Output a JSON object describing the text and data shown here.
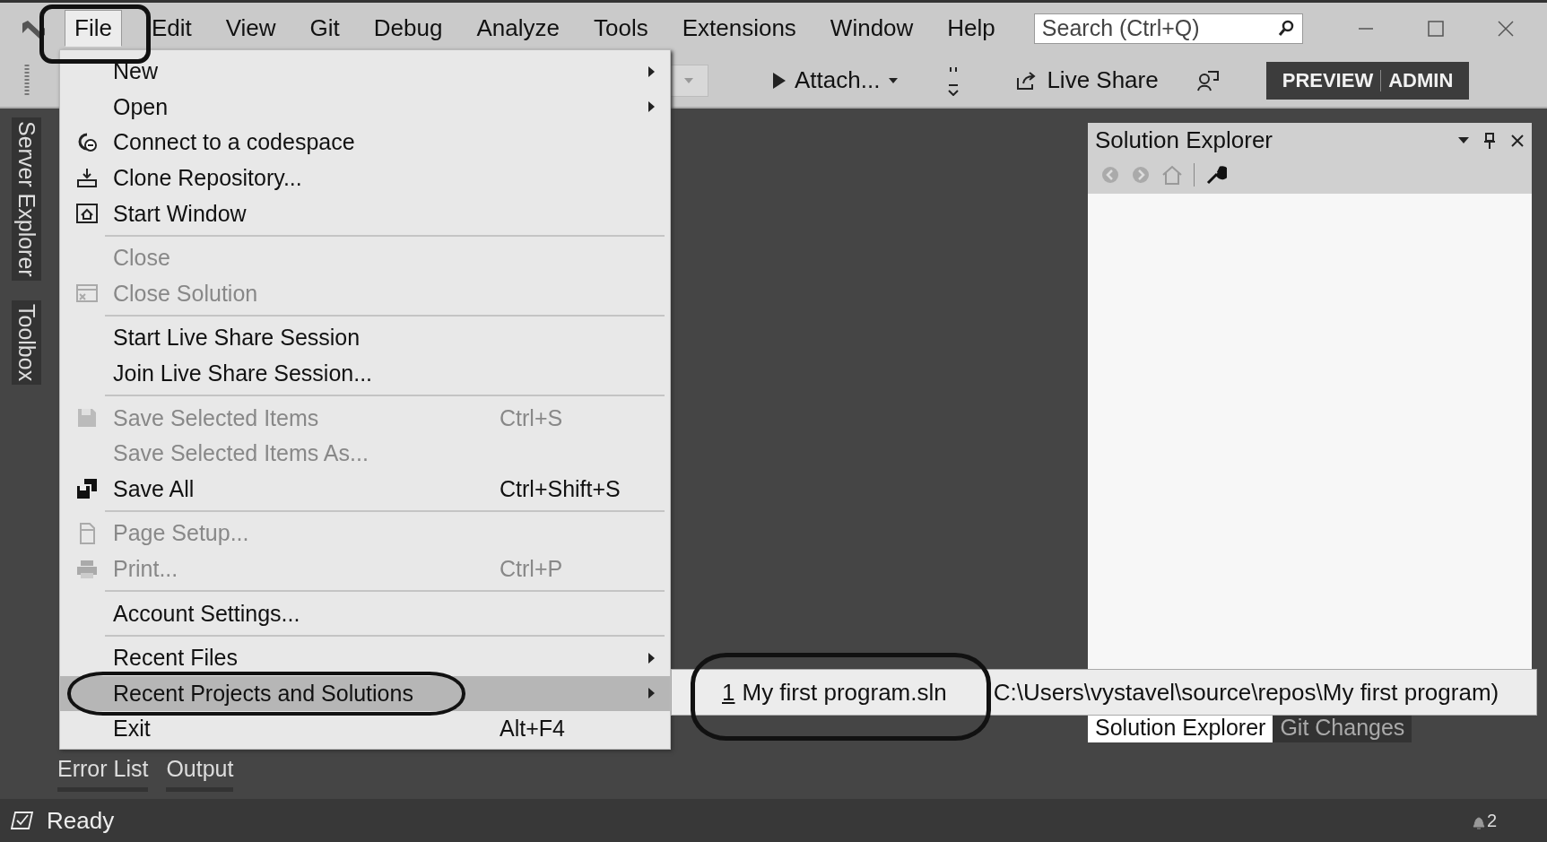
{
  "menu_bar": [
    {
      "label": "File",
      "selected": true
    },
    {
      "label": "Edit",
      "selected": false
    },
    {
      "label": "View",
      "selected": false
    },
    {
      "label": "Git",
      "selected": false
    },
    {
      "label": "Debug",
      "selected": false
    },
    {
      "label": "Analyze",
      "selected": false
    },
    {
      "label": "Tools",
      "selected": false
    },
    {
      "label": "Extensions",
      "selected": false
    },
    {
      "label": "Window",
      "selected": false
    },
    {
      "label": "Help",
      "selected": false
    }
  ],
  "search": {
    "placeholder": "Search (Ctrl+Q)"
  },
  "toolbar": {
    "attach": "Attach...",
    "live_share": "Live Share",
    "badge": {
      "left": "PREVIEW",
      "right": "ADMIN"
    }
  },
  "side_tabs": [
    "Server Explorer",
    "Toolbox"
  ],
  "file_menu": {
    "groups": [
      [
        {
          "label": "New",
          "submenu": true,
          "disabled": false,
          "selected": false
        },
        {
          "label": "Open",
          "submenu": true,
          "disabled": false,
          "selected": false
        },
        {
          "label": "Connect to a codespace",
          "submenu": false,
          "disabled": false,
          "selected": false
        },
        {
          "label": "Clone Repository...",
          "submenu": false,
          "disabled": false,
          "selected": false
        },
        {
          "label": "Start Window",
          "submenu": false,
          "disabled": false,
          "selected": false
        }
      ],
      [
        {
          "label": "Close",
          "submenu": false,
          "disabled": true,
          "selected": false
        },
        {
          "label": "Close Solution",
          "submenu": false,
          "disabled": true,
          "selected": false
        }
      ],
      [
        {
          "label": "Start Live Share Session",
          "submenu": false,
          "disabled": false,
          "selected": false
        },
        {
          "label": "Join Live Share Session...",
          "submenu": false,
          "disabled": false,
          "selected": false
        }
      ],
      [
        {
          "label": "Save Selected Items",
          "shortcut": "Ctrl+S",
          "submenu": false,
          "disabled": true,
          "selected": false
        },
        {
          "label": "Save Selected Items As...",
          "submenu": false,
          "disabled": true,
          "selected": false
        },
        {
          "label": "Save All",
          "shortcut": "Ctrl+Shift+S",
          "submenu": false,
          "disabled": false,
          "selected": false
        }
      ],
      [
        {
          "label": "Page Setup...",
          "submenu": false,
          "disabled": true,
          "selected": false
        },
        {
          "label": "Print...",
          "shortcut": "Ctrl+P",
          "submenu": false,
          "disabled": true,
          "selected": false
        }
      ],
      [
        {
          "label": "Account Settings...",
          "submenu": false,
          "disabled": false,
          "selected": false
        }
      ],
      [
        {
          "label": "Recent Files",
          "submenu": true,
          "disabled": false,
          "selected": false
        },
        {
          "label": "Recent Projects and Solutions",
          "submenu": true,
          "disabled": false,
          "selected": true
        },
        {
          "label": "Exit",
          "shortcut": "Alt+F4",
          "submenu": false,
          "disabled": false,
          "selected": false
        }
      ]
    ]
  },
  "recent_projects": [
    {
      "number": "1",
      "label": "My first program.sln",
      "path": "C:\\Users\\vystavel\\source\\repos\\My first program)"
    }
  ],
  "solution_explorer": {
    "title": "Solution Explorer"
  },
  "panel_tabs": [
    {
      "label": "Solution Explorer",
      "selected": true
    },
    {
      "label": "Git Changes",
      "selected": false
    }
  ],
  "bottom_tabs": [
    "Error List",
    "Output"
  ],
  "status_bar": {
    "text": "Ready",
    "notifications": "2"
  }
}
